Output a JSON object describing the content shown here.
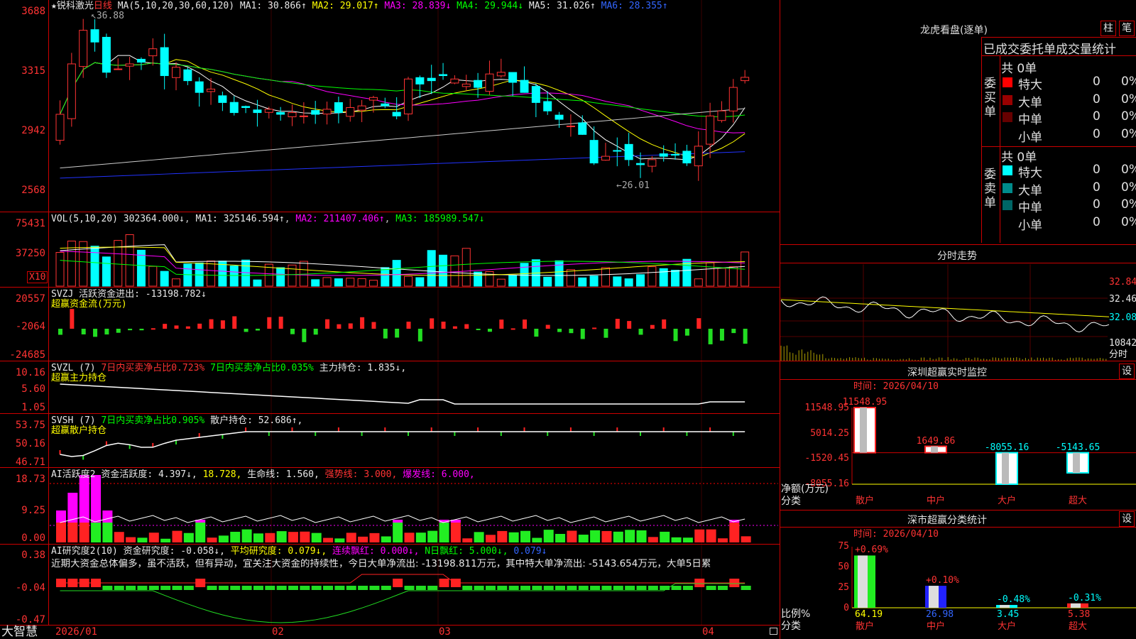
{
  "stock": {
    "name": "锐科激光",
    "period": "日线",
    "star": "★"
  },
  "main_header": {
    "ma_label": "MA(5,10,20,30,60,120)",
    "ma1": "MA1: 30.866↑",
    "ma2": "MA2: 29.017↑",
    "ma3": "MA3: 28.839↓",
    "ma4": "MA4: 29.944↓",
    "ma5": "MA5: 31.026↑",
    "ma6": "MA6: 28.355↑"
  },
  "main_axis": [
    "3688",
    "3315",
    "2942",
    "2568"
  ],
  "main_annot": {
    "high": "36.88",
    "low": "26.01"
  },
  "vol_header": {
    "label": "VOL(5,10,20)",
    "value": "302364.000↓",
    "ma1": "MA1: 325146.594↑",
    "ma2": "MA2: 211407.406↑",
    "ma3": "MA3: 185989.547↓"
  },
  "vol_axis": [
    "75431",
    "37250"
  ],
  "vol_unit": "X10",
  "svzj": {
    "label": "SVZJ",
    "title": "活跃资金进出: -13198.782↓",
    "sub": "超赢资金流(万元)",
    "axis": [
      "20557",
      "-2064",
      "-24685"
    ]
  },
  "svzl": {
    "label": "SVZL (7)",
    "a": "7日内买卖净占比0.723%",
    "b": "7日内买卖净占比0.035%",
    "c": "主力持仓: 1.835↓,",
    "sub": "超赢主力持仓",
    "axis": [
      "10.16",
      "5.60",
      "1.05"
    ]
  },
  "svsh": {
    "label": "SVSH (7)",
    "a": "7日内买卖净占比0.905%",
    "c": "散户持仓: 52.686↑,",
    "sub": "超赢散户持仓",
    "axis": [
      "53.75",
      "50.16",
      "46.71"
    ]
  },
  "ai1": {
    "label": "AI活跃度2",
    "a": "资金活跃度: 4.397↓,",
    "b": "18.728,",
    "c": "生命线: 1.560,",
    "d": "强势线: 3.000,",
    "e": "爆发线: 6.000,",
    "axis": [
      "18.73",
      "9.25",
      "0.00"
    ]
  },
  "ai2": {
    "label": "AI研究度2(10)",
    "a": "资金研究度: -0.058↓,",
    "b": "平均研究度: 0.079↓,",
    "c": "连续飘红: 0.000↓,",
    "d": "N日飘红: 5.000↓,",
    "e": "0.079↓",
    "axis": [
      "0.38",
      "-0.04",
      "-0.47"
    ],
    "comment": "近期大资金总体偏多，虽不活跃，但有异动，宜关注大资金的持续性，今日大单净流出: -13198.811万元，其中特大单净流出: -5143.654万元，大单5日累"
  },
  "xaxis": {
    "brand": "大智慧",
    "labels": [
      "2026/01",
      "02",
      "03",
      "04"
    ]
  },
  "lhb": {
    "title": "龙虎看盘(逐单)",
    "btn1": "柱",
    "btn2": "笔",
    "header": "已成交委托单成交量统计",
    "buy": {
      "side": "委买单",
      "total": "共 0单",
      "rows": [
        {
          "name": "特大",
          "v": "0",
          "p": "0%",
          "color": "#ff0000"
        },
        {
          "name": "大单",
          "v": "0",
          "p": "0%",
          "color": "#990000"
        },
        {
          "name": "中单",
          "v": "0",
          "p": "0%",
          "color": "#660000"
        },
        {
          "name": "小单",
          "v": "0",
          "p": "0%",
          "color": "#000000"
        }
      ]
    },
    "sell": {
      "side": "委卖单",
      "total": "共 0单",
      "rows": [
        {
          "name": "特大",
          "v": "0",
          "p": "0%",
          "color": "#00ffff"
        },
        {
          "name": "大单",
          "v": "0",
          "p": "0%",
          "color": "#008b8b"
        },
        {
          "name": "中单",
          "v": "0",
          "p": "0%",
          "color": "#006666"
        },
        {
          "name": "小单",
          "v": "0",
          "p": "0%",
          "color": "#000000"
        }
      ]
    }
  },
  "fenshi": {
    "title": "分时走势",
    "axis": [
      "32.84",
      "32.46",
      "32.08",
      "10842"
    ],
    "unit": "分时"
  },
  "monitor": {
    "title": "深圳超赢实时监控",
    "btn": "设",
    "time": "时间: 2026/04/10",
    "axis": [
      "11548.95",
      "5014.25",
      "-1520.45",
      "-8055.16"
    ],
    "ylabel": "净额(万元)",
    "xlabel": "分类"
  },
  "classify": {
    "title": "深市超赢分类统计",
    "btn": "设",
    "time": "时间: 2026/04/10",
    "axis": [
      "75",
      "50",
      "25",
      "0"
    ],
    "ylabel": "比例%",
    "xlabel": "分类"
  },
  "chart_data": [
    {
      "type": "bar",
      "title": "深圳超赢实时监控",
      "categories": [
        "散户",
        "中户",
        "大户",
        "超大"
      ],
      "values": [
        11548.95,
        1649.86,
        -8055.16,
        -5143.65
      ],
      "ylabel": "净额(万元)",
      "xlabel": "分类",
      "ylim": [
        -8055.16,
        11548.95
      ]
    },
    {
      "type": "bar",
      "title": "深市超赢分类统计",
      "categories": [
        "散户",
        "中户",
        "大户",
        "超大"
      ],
      "values": [
        64.19,
        26.98,
        3.45,
        5.38
      ],
      "changes": [
        "+0.69%",
        "+0.10%",
        "-0.48%",
        "-0.31%"
      ],
      "ylabel": "比例%",
      "xlabel": "分类",
      "ylim": [
        0,
        75
      ]
    },
    {
      "type": "line",
      "title": "锐科激光 日线",
      "ylim": [
        25.68,
        36.88
      ],
      "high": 36.88,
      "low": 26.01,
      "ma": [
        30.866,
        29.017,
        28.839,
        29.944,
        31.026,
        28.355
      ]
    }
  ]
}
